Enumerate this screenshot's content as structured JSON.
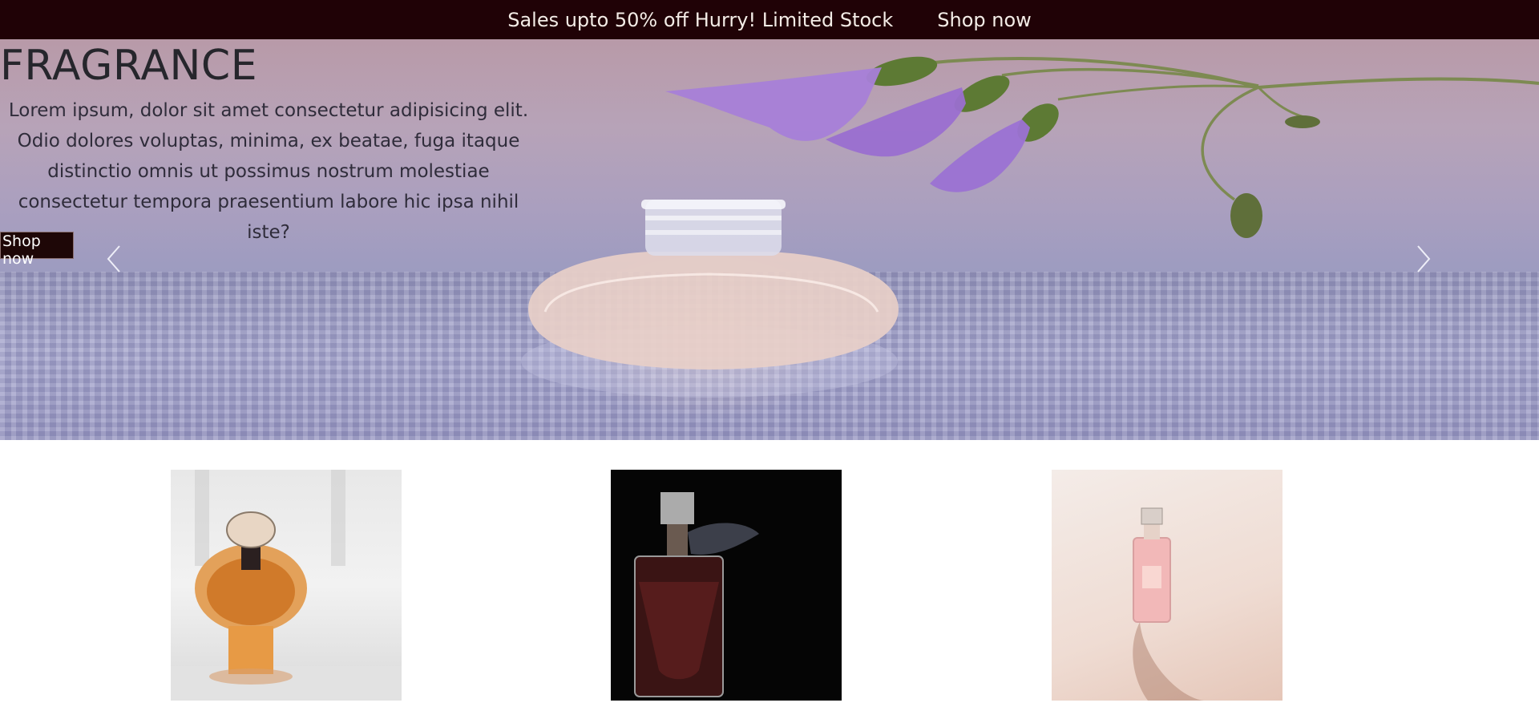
{
  "topbar": {
    "promo_text": "Sales upto 50% off Hurry! Limited Stock",
    "cta_label": "Shop now"
  },
  "hero": {
    "title": "FRAGRANCE",
    "description": "Lorem ipsum, dolor sit amet consectetur adipisicing elit. Odio dolores voluptas, minima, ex beatae, fuga itaque distinctio omnis ut possimus nostrum molestiae consectetur tempora praesentium labore hic ipsa nihil iste?",
    "button_label": "Shop now",
    "prev_icon": "chevron-left-icon",
    "next_icon": "chevron-right-icon"
  },
  "products": [
    {
      "name": "perfume-bottle-amber"
    },
    {
      "name": "perfume-bottle-dark"
    },
    {
      "name": "perfume-bottle-pink"
    }
  ],
  "colors": {
    "topbar_bg": "#200206",
    "topbar_text": "#f3ece6",
    "hero_button_bg": "#1e0707"
  }
}
